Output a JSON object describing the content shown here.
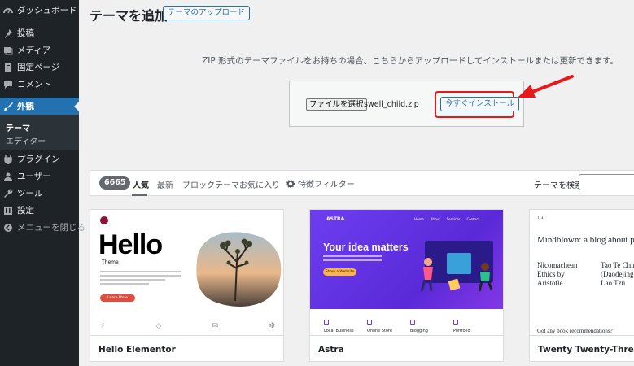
{
  "sidebar": {
    "items": [
      {
        "label": "ダッシュボード",
        "icon": "dashboard-icon"
      },
      {
        "label": "投稿",
        "icon": "pin-icon"
      },
      {
        "label": "メディア",
        "icon": "media-icon"
      },
      {
        "label": "固定ページ",
        "icon": "page-icon"
      },
      {
        "label": "コメント",
        "icon": "comment-icon"
      },
      {
        "label": "外観",
        "icon": "brush-icon",
        "active": true
      },
      {
        "label": "プラグイン",
        "icon": "plugin-icon"
      },
      {
        "label": "ユーザー",
        "icon": "user-icon"
      },
      {
        "label": "ツール",
        "icon": "wrench-icon"
      },
      {
        "label": "設定",
        "icon": "settings-icon"
      },
      {
        "label": "メニューを閉じる",
        "icon": "collapse-icon"
      }
    ],
    "submenu": [
      {
        "label": "テーマ",
        "current": true
      },
      {
        "label": "エディター",
        "current": false
      }
    ]
  },
  "header": {
    "title": "テーマを追加",
    "upload_button": "テーマのアップロード"
  },
  "upload": {
    "description": "ZIP 形式のテーマファイルをお持ちの場合、こちらからアップロードしてインストールまたは更新できます。",
    "file_button": "ファイルを選択",
    "file_name": "swell_child.zip",
    "install_button": "今すぐインストール",
    "highlight_color": "#e8191d"
  },
  "filter": {
    "count": "6665",
    "tabs": [
      "人気",
      "最新",
      "ブロックテーマ",
      "お気に入り"
    ],
    "active_tab": "人気",
    "feature_filter": "特徴フィルター",
    "search_label": "テーマを検索"
  },
  "themes": [
    {
      "name": "Hello Elementor",
      "preview": {
        "title": "Hello",
        "subtitle": "Theme",
        "cta": "Learn More"
      }
    },
    {
      "name": "Astra",
      "preview": {
        "brand": "ASTRA",
        "headline": "Your idea matters",
        "nav": [
          "Home",
          "About",
          "Services",
          "Contact"
        ],
        "button": "Show a Website",
        "features": [
          "Local Business",
          "Online Store",
          "Blogging",
          "Portfolio"
        ]
      }
    },
    {
      "name": "Twenty Twenty-Three",
      "preview": {
        "site": "TT3",
        "headline": "Mindblown: a blog about phi",
        "post1": [
          "Nicomachean",
          "Ethics by",
          "Aristotle"
        ],
        "post2": [
          "Tao Te Chin",
          "(Daodejing)",
          "Lao Tzu"
        ],
        "question": "Got any book recommendations?"
      }
    }
  ],
  "colors": {
    "accent": "#2271b1",
    "sidebar_bg": "#1d2327",
    "arrow": "#e8191d"
  }
}
